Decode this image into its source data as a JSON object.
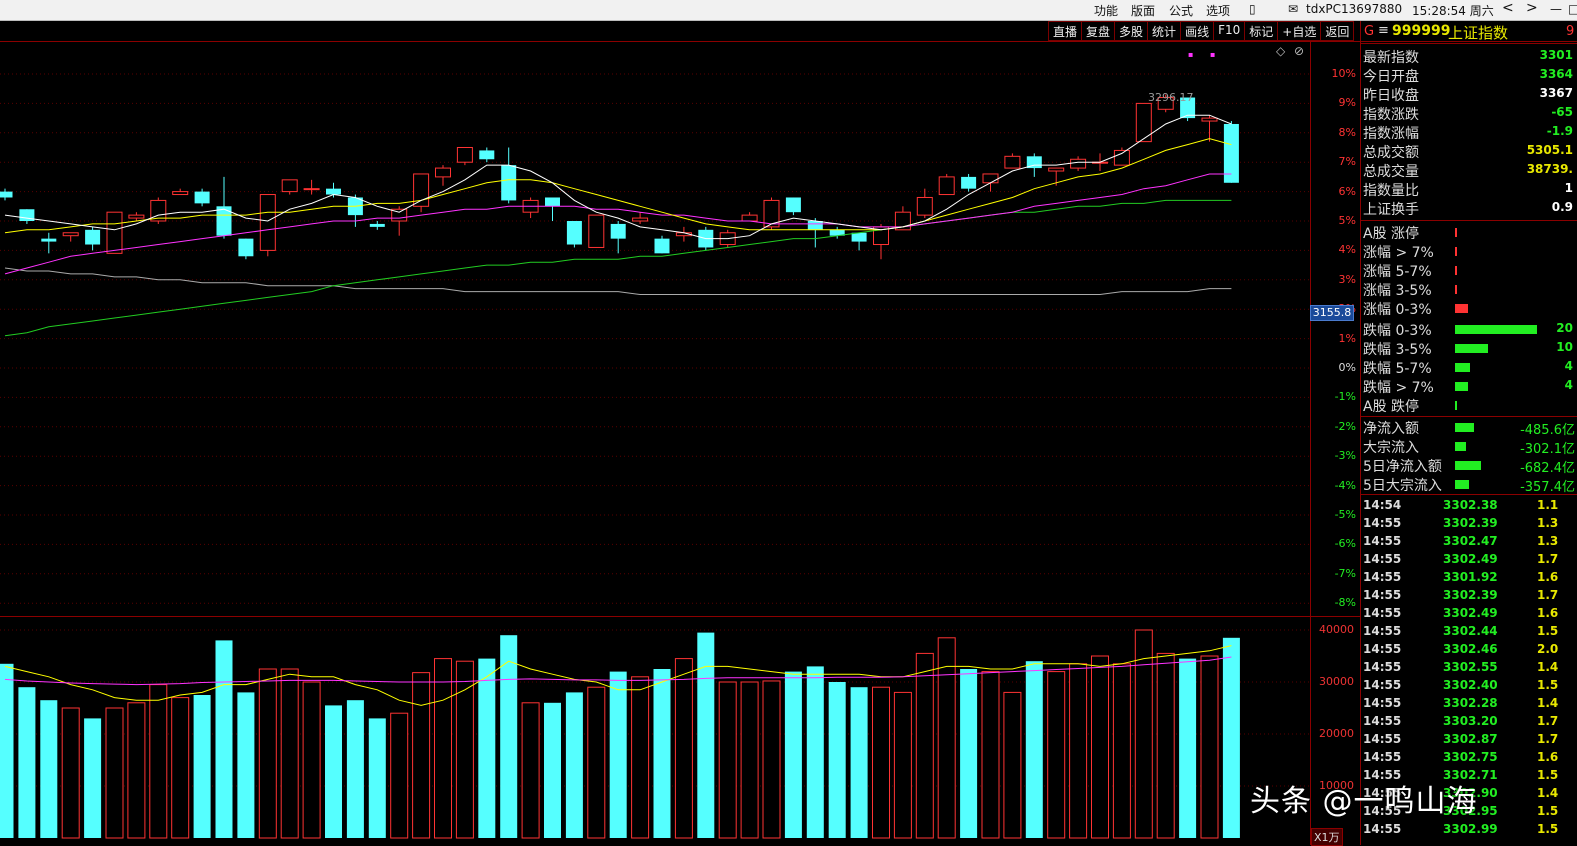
{
  "topbar": {
    "menu": [
      "功能",
      "版面",
      "公式",
      "选项"
    ],
    "mail_icon": "mail-icon",
    "user": "tdxPC13697880",
    "clock": "15:28:54 周六",
    "nav": [
      "<",
      ">",
      "—",
      "□"
    ]
  },
  "toolbar": [
    "直播",
    "复盘",
    "多股",
    "统计",
    "画线",
    "F10",
    "标记",
    "+自选",
    "返回"
  ],
  "chart": {
    "last_label": "3155.8",
    "high_annotation": "3296.17",
    "pct_labels": [
      "10%",
      "9%",
      "8%",
      "7%",
      "6%",
      "5%",
      "4%",
      "3%",
      "2%",
      "1%",
      "0%",
      "-1%",
      "-2%",
      "-3%",
      "-4%",
      "-5%",
      "-6%",
      "-7%",
      "-8%"
    ],
    "vol_labels": [
      "40000",
      "30000",
      "20000",
      "10000"
    ],
    "vol_unit": "X1万"
  },
  "chart_data": {
    "type": "candlestick",
    "candles": [
      {
        "open": 6.0,
        "close": 5.8,
        "high": 6.1,
        "low": 5.7
      },
      {
        "open": 5.4,
        "close": 5.0,
        "high": 5.4,
        "low": 4.9
      },
      {
        "open": 4.4,
        "close": 4.3,
        "high": 4.6,
        "low": 3.9
      },
      {
        "open": 4.5,
        "close": 4.6,
        "high": 4.6,
        "low": 4.3
      },
      {
        "open": 4.7,
        "close": 4.2,
        "high": 4.8,
        "low": 4.0
      },
      {
        "open": 3.9,
        "close": 5.3,
        "high": 5.3,
        "low": 3.9
      },
      {
        "open": 5.1,
        "close": 5.2,
        "high": 5.3,
        "low": 5.0
      },
      {
        "open": 5.0,
        "close": 5.7,
        "high": 5.8,
        "low": 4.9
      },
      {
        "open": 5.9,
        "close": 6.0,
        "high": 6.1,
        "low": 5.9
      },
      {
        "open": 6.0,
        "close": 5.6,
        "high": 6.1,
        "low": 5.5
      },
      {
        "open": 5.5,
        "close": 4.5,
        "high": 6.5,
        "low": 4.4
      },
      {
        "open": 4.4,
        "close": 3.8,
        "high": 4.4,
        "low": 3.7
      },
      {
        "open": 4.0,
        "close": 5.9,
        "high": 5.9,
        "low": 3.8
      },
      {
        "open": 6.0,
        "close": 6.4,
        "high": 6.4,
        "low": 5.9
      },
      {
        "open": 6.1,
        "close": 6.1,
        "high": 6.4,
        "low": 5.9
      },
      {
        "open": 6.1,
        "close": 5.9,
        "high": 6.3,
        "low": 5.8
      },
      {
        "open": 5.8,
        "close": 5.2,
        "high": 5.9,
        "low": 4.8
      },
      {
        "open": 4.9,
        "close": 4.8,
        "high": 5.0,
        "low": 4.7
      },
      {
        "open": 5.0,
        "close": 5.4,
        "high": 5.5,
        "low": 4.5
      },
      {
        "open": 5.5,
        "close": 6.6,
        "high": 6.6,
        "low": 5.3
      },
      {
        "open": 6.5,
        "close": 6.8,
        "high": 6.9,
        "low": 6.2
      },
      {
        "open": 7.0,
        "close": 7.5,
        "high": 7.5,
        "low": 6.9
      },
      {
        "open": 7.4,
        "close": 7.1,
        "high": 7.5,
        "low": 7.0
      },
      {
        "open": 6.9,
        "close": 5.7,
        "high": 7.5,
        "low": 5.6
      },
      {
        "open": 5.3,
        "close": 5.7,
        "high": 5.8,
        "low": 5.1
      },
      {
        "open": 5.8,
        "close": 5.5,
        "high": 5.8,
        "low": 5.0
      },
      {
        "open": 5.0,
        "close": 4.2,
        "high": 5.0,
        "low": 4.1
      },
      {
        "open": 4.1,
        "close": 5.2,
        "high": 5.2,
        "low": 4.1
      },
      {
        "open": 4.9,
        "close": 4.4,
        "high": 5.0,
        "low": 3.9
      },
      {
        "open": 5.0,
        "close": 5.1,
        "high": 5.3,
        "low": 4.9
      },
      {
        "open": 4.4,
        "close": 3.9,
        "high": 4.5,
        "low": 3.9
      },
      {
        "open": 4.5,
        "close": 4.6,
        "high": 4.8,
        "low": 4.3
      },
      {
        "open": 4.7,
        "close": 4.1,
        "high": 4.8,
        "low": 4.0
      },
      {
        "open": 4.2,
        "close": 4.6,
        "high": 4.7,
        "low": 4.1
      },
      {
        "open": 5.0,
        "close": 5.2,
        "high": 5.3,
        "low": 5.0
      },
      {
        "open": 4.8,
        "close": 5.7,
        "high": 5.8,
        "low": 4.7
      },
      {
        "open": 5.8,
        "close": 5.3,
        "high": 5.8,
        "low": 5.2
      },
      {
        "open": 5.0,
        "close": 4.7,
        "high": 5.1,
        "low": 4.1
      },
      {
        "open": 4.7,
        "close": 4.5,
        "high": 4.8,
        "low": 4.4
      },
      {
        "open": 4.6,
        "close": 4.3,
        "high": 4.6,
        "low": 4.0
      },
      {
        "open": 4.2,
        "close": 4.8,
        "high": 4.9,
        "low": 3.7
      },
      {
        "open": 4.7,
        "close": 5.3,
        "high": 5.5,
        "low": 4.7
      },
      {
        "open": 5.2,
        "close": 5.8,
        "high": 6.1,
        "low": 5.1
      },
      {
        "open": 5.9,
        "close": 6.5,
        "high": 6.6,
        "low": 5.9
      },
      {
        "open": 6.5,
        "close": 6.1,
        "high": 6.6,
        "low": 6.0
      },
      {
        "open": 6.3,
        "close": 6.6,
        "high": 6.6,
        "low": 6.0
      },
      {
        "open": 6.8,
        "close": 7.2,
        "high": 7.3,
        "low": 6.8
      },
      {
        "open": 7.2,
        "close": 6.8,
        "high": 7.3,
        "low": 6.5
      },
      {
        "open": 6.7,
        "close": 6.8,
        "high": 6.8,
        "low": 6.2
      },
      {
        "open": 6.8,
        "close": 7.1,
        "high": 7.2,
        "low": 6.7
      },
      {
        "open": 7.0,
        "close": 7.0,
        "high": 7.3,
        "low": 6.7
      },
      {
        "open": 6.9,
        "close": 7.4,
        "high": 7.5,
        "low": 6.9
      },
      {
        "open": 7.7,
        "close": 9.0,
        "high": 9.0,
        "low": 7.7
      },
      {
        "open": 8.8,
        "close": 9.2,
        "high": 9.3,
        "low": 8.7
      },
      {
        "open": 9.2,
        "close": 8.5,
        "high": 9.2,
        "low": 8.4
      },
      {
        "open": 8.4,
        "close": 8.5,
        "high": 8.6,
        "low": 7.7
      },
      {
        "open": 8.3,
        "close": 6.3,
        "high": 8.4,
        "low": 6.3
      }
    ],
    "volumes": [
      33500,
      29000,
      26500,
      25000,
      23000,
      25000,
      26000,
      29500,
      27000,
      27500,
      38000,
      28000,
      32500,
      32500,
      30000,
      25500,
      26500,
      23000,
      24000,
      31800,
      34500,
      34000,
      34500,
      39000,
      26000,
      26000,
      28000,
      29000,
      32000,
      31000,
      32500,
      34500,
      39500,
      30000,
      30000,
      30200,
      32000,
      33000,
      30000,
      29000,
      29000,
      28000,
      35500,
      38500,
      32500,
      32000,
      28000,
      34000,
      32000,
      33500,
      35000,
      33500,
      40000,
      35500,
      34500,
      35000,
      38500
    ],
    "ma5_pct": [
      5.2,
      5.1,
      5.0,
      4.9,
      4.8,
      4.7,
      4.9,
      5.2,
      5.3,
      5.3,
      5.4,
      5.1,
      5.0,
      5.4,
      5.6,
      5.9,
      5.8,
      5.5,
      5.3,
      5.7,
      6.0,
      6.4,
      6.9,
      6.9,
      6.7,
      6.3,
      5.7,
      5.3,
      5.1,
      4.8,
      4.7,
      4.6,
      4.4,
      4.4,
      4.5,
      4.9,
      5.1,
      5.0,
      4.9,
      4.8,
      4.7,
      4.8,
      5.0,
      5.4,
      5.9,
      6.3,
      6.7,
      6.9,
      6.9,
      7.0,
      7.0,
      7.3,
      7.8,
      8.3,
      8.6,
      8.6,
      8.3
    ],
    "ma10_pct": [
      4.6,
      4.7,
      4.7,
      4.8,
      4.9,
      4.9,
      5.0,
      5.1,
      5.1,
      5.2,
      5.2,
      5.2,
      5.3,
      5.3,
      5.4,
      5.5,
      5.5,
      5.6,
      5.6,
      5.7,
      5.9,
      6.1,
      6.3,
      6.4,
      6.4,
      6.3,
      6.1,
      5.9,
      5.7,
      5.5,
      5.3,
      5.1,
      4.9,
      4.8,
      4.7,
      4.7,
      4.7,
      4.7,
      4.7,
      4.7,
      4.7,
      4.8,
      5.0,
      5.2,
      5.4,
      5.6,
      5.8,
      6.1,
      6.3,
      6.5,
      6.6,
      6.8,
      7.1,
      7.4,
      7.6,
      7.8,
      7.6
    ],
    "ma20_pct": [
      3.2,
      3.4,
      3.6,
      3.8,
      3.9,
      4.0,
      4.1,
      4.2,
      4.3,
      4.4,
      4.5,
      4.6,
      4.7,
      4.8,
      4.9,
      5.0,
      5.0,
      5.1,
      5.1,
      5.2,
      5.3,
      5.4,
      5.4,
      5.5,
      5.5,
      5.5,
      5.5,
      5.4,
      5.4,
      5.3,
      5.2,
      5.2,
      5.1,
      5.0,
      5.0,
      4.9,
      4.9,
      4.9,
      4.9,
      4.8,
      4.8,
      4.8,
      4.9,
      5.0,
      5.1,
      5.2,
      5.3,
      5.5,
      5.6,
      5.7,
      5.8,
      5.9,
      6.1,
      6.2,
      6.4,
      6.6,
      6.6
    ],
    "ma60_pct": [
      1.1,
      1.2,
      1.4,
      1.5,
      1.6,
      1.7,
      1.8,
      1.9,
      2.0,
      2.1,
      2.2,
      2.3,
      2.4,
      2.5,
      2.6,
      2.8,
      2.9,
      3.0,
      3.1,
      3.2,
      3.3,
      3.4,
      3.5,
      3.5,
      3.6,
      3.6,
      3.7,
      3.7,
      3.7,
      3.8,
      3.8,
      3.9,
      4.0,
      4.1,
      4.2,
      4.3,
      4.4,
      4.4,
      4.5,
      4.6,
      4.7,
      4.8,
      4.9,
      5.0,
      5.1,
      5.2,
      5.3,
      5.3,
      5.4,
      5.5,
      5.5,
      5.6,
      5.6,
      5.7,
      5.7,
      5.7,
      5.7
    ],
    "ma_long_pct": [
      3.4,
      3.3,
      3.3,
      3.2,
      3.2,
      3.1,
      3.1,
      3.0,
      3.0,
      2.9,
      2.9,
      2.9,
      2.8,
      2.8,
      2.8,
      2.8,
      2.7,
      2.7,
      2.7,
      2.7,
      2.7,
      2.6,
      2.6,
      2.6,
      2.6,
      2.6,
      2.6,
      2.6,
      2.6,
      2.5,
      2.5,
      2.5,
      2.5,
      2.5,
      2.5,
      2.5,
      2.5,
      2.5,
      2.5,
      2.5,
      2.5,
      2.5,
      2.5,
      2.5,
      2.5,
      2.5,
      2.5,
      2.5,
      2.5,
      2.5,
      2.5,
      2.6,
      2.6,
      2.6,
      2.6,
      2.7,
      2.7
    ],
    "vol_ma_a": [
      33000,
      32000,
      31000,
      29500,
      28500,
      27000,
      26500,
      26500,
      27500,
      28000,
      29500,
      29500,
      30500,
      31500,
      31000,
      31000,
      29500,
      28500,
      26500,
      25500,
      26500,
      28500,
      31000,
      34000,
      32500,
      31500,
      30500,
      30000,
      28500,
      28500,
      30000,
      31500,
      33000,
      33000,
      32500,
      32000,
      31500,
      31500,
      31500,
      31500,
      31000,
      31000,
      32000,
      33000,
      33000,
      32500,
      32500,
      33500,
      33500,
      33500,
      33000,
      33500,
      34500,
      35000,
      35500,
      36000,
      37000
    ],
    "vol_ma_b": [
      30500,
      30200,
      30000,
      29800,
      29700,
      29600,
      29500,
      29600,
      29700,
      29900,
      30000,
      30100,
      30200,
      30300,
      30300,
      30300,
      30200,
      30100,
      30000,
      30000,
      30000,
      30100,
      30300,
      30500,
      30600,
      30500,
      30400,
      30400,
      30300,
      30300,
      30400,
      30500,
      30700,
      30800,
      30800,
      30800,
      30800,
      30800,
      30900,
      30900,
      30900,
      31000,
      31200,
      31400,
      31600,
      31800,
      32000,
      32200,
      32400,
      32600,
      32800,
      33000,
      33300,
      33600,
      33900,
      34200,
      34800
    ]
  },
  "panel": {
    "g": "G",
    "code": "999999",
    "name": "上证指数",
    "extra": "9",
    "stats": [
      {
        "label": "最新指数",
        "value": "3301",
        "color": "#22ee22"
      },
      {
        "label": "今日开盘",
        "value": "3364",
        "color": "#22ee22"
      },
      {
        "label": "昨日收盘",
        "value": "3367",
        "color": "#ffffff"
      },
      {
        "label": "指数涨跌",
        "value": "-65",
        "color": "#22ee22"
      },
      {
        "label": "指数涨幅",
        "value": "-1.9",
        "color": "#22ee22"
      },
      {
        "label": "总成交额",
        "value": "5305.1",
        "color": "#e8e800"
      },
      {
        "label": "总成交量",
        "value": "38739.",
        "color": "#e8e800"
      },
      {
        "label": "指数量比",
        "value": "1",
        "color": "#ffffff"
      },
      {
        "label": "上证换手",
        "value": "0.9",
        "color": "#ffffff"
      }
    ],
    "breadth_up": [
      {
        "label": "A股 涨停",
        "bar": 0.01,
        "color": "#ff3333"
      },
      {
        "label": "涨幅 > 7%",
        "bar": 0.01,
        "color": "#ff3333"
      },
      {
        "label": "涨幅 5-7%",
        "bar": 0.01,
        "color": "#ff3333"
      },
      {
        "label": "涨幅 3-5%",
        "bar": 0.03,
        "color": "#ff3333"
      },
      {
        "label": "涨幅 0-3%",
        "bar": 0.16,
        "color": "#ff3333"
      }
    ],
    "breadth_down": [
      {
        "label": "跌幅 0-3%",
        "bar": 1.0,
        "color": "#22ee22",
        "num": "20"
      },
      {
        "label": "跌幅 3-5%",
        "bar": 0.4,
        "color": "#22ee22",
        "num": "10"
      },
      {
        "label": "跌幅 5-7%",
        "bar": 0.18,
        "color": "#22ee22",
        "num": "4"
      },
      {
        "label": "跌幅 > 7%",
        "bar": 0.16,
        "color": "#22ee22",
        "num": "4"
      },
      {
        "label": "A股 跌停",
        "bar": 0.01,
        "color": "#22ee22",
        "num": ""
      }
    ],
    "flows": [
      {
        "label": "净流入额",
        "bar": 0.55,
        "value": "-485.6亿"
      },
      {
        "label": "大宗流入",
        "bar": 0.32,
        "value": "-302.1亿"
      },
      {
        "label": "5日净流入额",
        "bar": 0.75,
        "value": "-682.4亿"
      },
      {
        "label": "5日大宗流入",
        "bar": 0.4,
        "value": "-357.4亿"
      }
    ],
    "ticks": [
      {
        "t": "14:54",
        "p": "3302.38",
        "v": "1.1"
      },
      {
        "t": "14:55",
        "p": "3302.39",
        "v": "1.3"
      },
      {
        "t": "14:55",
        "p": "3302.47",
        "v": "1.3"
      },
      {
        "t": "14:55",
        "p": "3302.49",
        "v": "1.7"
      },
      {
        "t": "14:55",
        "p": "3301.92",
        "v": "1.6"
      },
      {
        "t": "14:55",
        "p": "3302.39",
        "v": "1.7"
      },
      {
        "t": "14:55",
        "p": "3302.49",
        "v": "1.6"
      },
      {
        "t": "14:55",
        "p": "3302.44",
        "v": "1.5"
      },
      {
        "t": "14:55",
        "p": "3302.46",
        "v": "2.0"
      },
      {
        "t": "14:55",
        "p": "3302.55",
        "v": "1.4"
      },
      {
        "t": "14:55",
        "p": "3302.40",
        "v": "1.5"
      },
      {
        "t": "14:55",
        "p": "3302.28",
        "v": "1.4"
      },
      {
        "t": "14:55",
        "p": "3303.20",
        "v": "1.7"
      },
      {
        "t": "14:55",
        "p": "3302.87",
        "v": "1.7"
      },
      {
        "t": "14:55",
        "p": "3302.75",
        "v": "1.6"
      },
      {
        "t": "14:55",
        "p": "3302.71",
        "v": "1.5"
      },
      {
        "t": "14:55",
        "p": "3302.90",
        "v": "1.4"
      },
      {
        "t": "14:55",
        "p": "3302.95",
        "v": "1.5"
      },
      {
        "t": "14:55",
        "p": "3302.99",
        "v": "1.5"
      }
    ]
  },
  "watermark": "头条 @一鸣山海",
  "colors": {
    "up": "#ff3333",
    "down": "#55ffff",
    "grid": "#8b0000",
    "ma5": "#ffffff",
    "ma10": "#ffff00",
    "ma20": "#ff33ff",
    "ma60": "#22cc22",
    "ma_long": "#aaaaaa"
  }
}
